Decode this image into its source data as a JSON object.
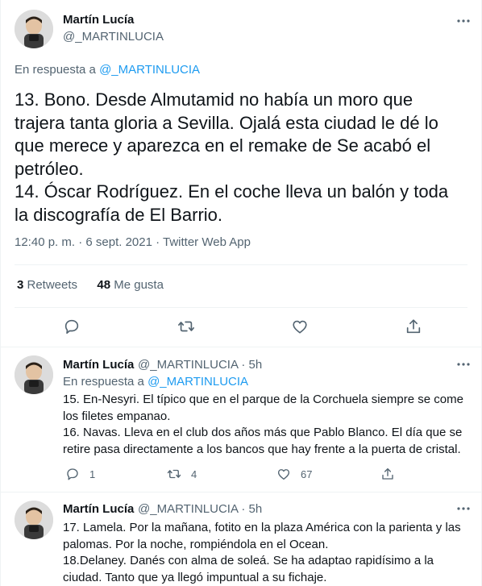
{
  "main_tweet": {
    "author_name": "Martín Lucía",
    "author_handle": "@_MARTINLUCIA",
    "reply_prefix": "En respuesta a ",
    "reply_handle": "@_MARTINLUCIA",
    "lines": [
      "13. Bono. Desde Almutamid no había un moro que",
      "trajera tanta gloria a Sevilla. Ojalá esta ciudad le dé lo",
      "que merece y aparezca en el remake de Se acabó el",
      "petróleo.",
      "14. Óscar Rodríguez. En el coche lleva un balón y toda",
      "la discografía de El Barrio."
    ],
    "timestamp": "12:40 p. m. · 6 sept. 2021 · Twitter Web App",
    "retweets_count": "3",
    "retweets_label": " Retweets",
    "likes_count": "48",
    "likes_label": " Me gusta"
  },
  "replies": [
    {
      "author_name": "Martín Lucía",
      "author_handle": "@_MARTINLUCIA · 5h",
      "reply_prefix": "En respuesta a ",
      "reply_handle": "@_MARTINLUCIA",
      "lines": [
        "15. En-Nesyri. El típico que en el parque de la Corchuela siempre se come",
        "los filetes empanao.",
        "16. Navas. Lleva en el club dos años más que Pablo Blanco. El día que se",
        "retire pasa directamente a los bancos que hay frente a la puerta de cristal."
      ],
      "reply_count": "1",
      "retweet_count": "4",
      "like_count": "67"
    },
    {
      "author_name": "Martín Lucía",
      "author_handle": "@_MARTINLUCIA · 5h",
      "lines": [
        "17. Lamela. Por la mañana, fotito en la plaza América con la parienta y las",
        "palomas. Por la noche, rompiéndola en el Ocean.",
        "18.Delaney. Danés con alma de soleá. Se ha adaptao rapidísimo a la",
        "ciudad. Tanto que ya llegó impuntual a su fichaje."
      ]
    }
  ],
  "colors": {
    "accent": "#1d9bf0",
    "secondary_text": "#536471",
    "primary_text": "#0f1419",
    "divider": "#eff3f4"
  },
  "icons": {
    "more": "more-icon",
    "reply": "reply-icon",
    "retweet": "retweet-icon",
    "like": "like-icon",
    "share": "share-icon"
  }
}
